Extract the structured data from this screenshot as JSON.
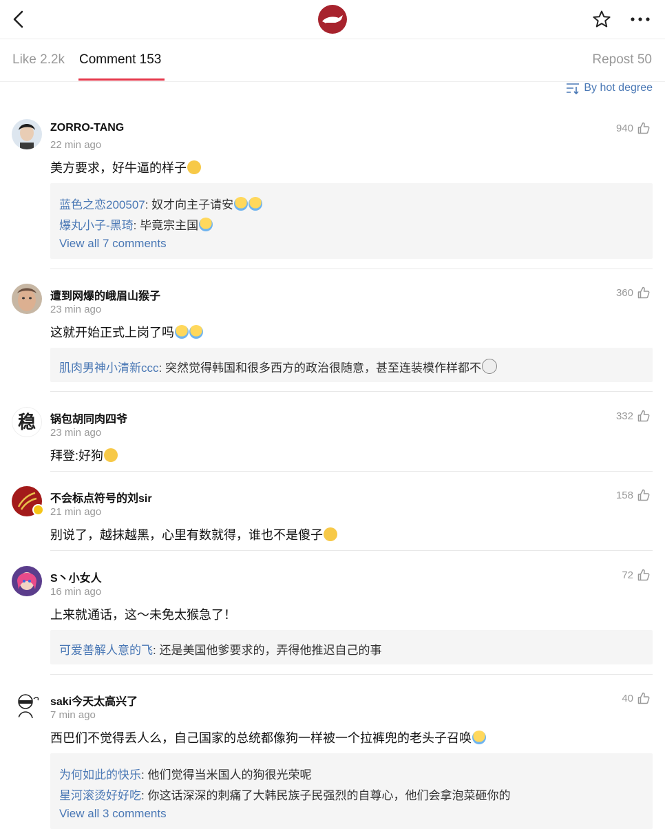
{
  "tabs": {
    "like": "Like 2.2k",
    "comment": "Comment 153",
    "repost": "Repost 50"
  },
  "sort_label": "By hot degree",
  "icons": {
    "back": "chevron-left-icon",
    "star": "star-icon",
    "more": "more-icon",
    "like": "thumb-up-icon",
    "sort": "sort-icon"
  },
  "colors": {
    "accent": "#e5364a",
    "link": "#4a78b5",
    "brand": "#a7232d"
  },
  "comments": [
    {
      "user": "ZORRO-TANG",
      "time": "22 min ago",
      "likes": "940",
      "text": "美方要求，好牛逼的样子",
      "replies": [
        {
          "name": "蓝色之恋200507",
          "text": ": 奴才向主子请安"
        },
        {
          "name": "爆丸小子-黑琦",
          "text": ": 毕竟宗主国"
        }
      ],
      "view_all": "View all 7 comments"
    },
    {
      "user": "遭到网爆的峨眉山猴子",
      "time": "23 min ago",
      "likes": "360",
      "text": "这就开始正式上岗了吗",
      "replies": [
        {
          "name": "肌肉男神小清新ccc",
          "text": ": 突然觉得韩国和很多西方的政治很随意，甚至连装模作样都不"
        }
      ]
    },
    {
      "user": "锅包胡同肉四爷",
      "avatar_text": "稳",
      "time": "23 min ago",
      "likes": "332",
      "text": "拜登:好狗"
    },
    {
      "user": "不会标点符号的刘sir",
      "time": "21 min ago",
      "likes": "158",
      "text": "别说了，越抹越黑，心里有数就得，谁也不是傻子"
    },
    {
      "user": "S丶小女人",
      "time": "16 min ago",
      "likes": "72",
      "text": "上来就通话，这～未免太猴急了！",
      "replies": [
        {
          "name": "可爱善解人意的飞",
          "text": ": 还是美国他爹要求的，弄得他推迟自己的事"
        }
      ]
    },
    {
      "user": "saki今天太高兴了",
      "time": "7 min ago",
      "likes": "40",
      "text": "西巴们不觉得丢人么，自己国家的总统都像狗一样被一个拉裤兜的老头子召唤",
      "replies": [
        {
          "name": "为何如此的快乐",
          "text": ": 他们觉得当米国人的狗很光荣呢"
        },
        {
          "name": "星河滚烫好好吃",
          "text": ": 你这话深深的刺痛了大韩民族子民强烈的自尊心，他们会拿泡菜砸你的"
        }
      ],
      "view_all": "View all 3 comments"
    }
  ]
}
